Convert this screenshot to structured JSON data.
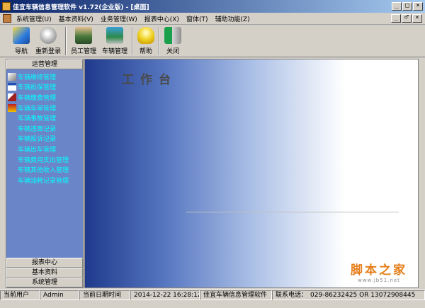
{
  "window": {
    "title": "佳宜车辆信息管理软件 v1.72(企业版) - [桌面]",
    "controls": [
      "_",
      "□",
      "×"
    ]
  },
  "menubar": {
    "items": [
      "系统管理(U)",
      "基本资料(V)",
      "业务管理(W)",
      "报表中心(X)",
      "窗体(T)",
      "辅助功能(Z)"
    ],
    "mdi_controls": [
      "_",
      "♂",
      "×"
    ]
  },
  "toolbar": {
    "buttons": [
      {
        "label": "导航",
        "icon": "wand-icon",
        "color": "#2c7be0"
      },
      {
        "label": "重新登录",
        "icon": "lock-icon",
        "color": "#c0c0c0"
      },
      {
        "label": "员工管理",
        "icon": "users-icon",
        "color": "#4a7a3c"
      },
      {
        "label": "车辆管理",
        "icon": "vehicle-icon",
        "color": "#2c8a4a"
      },
      {
        "label": "帮助",
        "icon": "lightbulb-icon",
        "color": "#f0d020"
      },
      {
        "label": "关闭",
        "icon": "exit-door-icon",
        "color": "#1aa04a"
      }
    ]
  },
  "sidebar": {
    "header": "运营管理",
    "items": [
      {
        "label": "车辆维修管理",
        "icon": "wrench-icon"
      },
      {
        "label": "车辆投保管理",
        "icon": "document-icon"
      },
      {
        "label": "车辆缴费管理",
        "icon": "pen-icon"
      },
      {
        "label": "车辆年审管理",
        "icon": "calendar-icon"
      },
      {
        "label": "车辆事故管理",
        "icon": ""
      },
      {
        "label": "车辆违章记录",
        "icon": ""
      },
      {
        "label": "车辆投诉记录",
        "icon": ""
      },
      {
        "label": "车辆出车管理",
        "icon": ""
      },
      {
        "label": "车辆费用支出管理",
        "icon": ""
      },
      {
        "label": "车辆其他收入管理",
        "icon": ""
      },
      {
        "label": "车辆油耗记录管理",
        "icon": ""
      }
    ],
    "bottom_panels": [
      "报表中心",
      "基本资料",
      "系统管理"
    ]
  },
  "workspace": {
    "title": "工作台",
    "watermark": "脚本之家",
    "watermark_url": "www.jb51.net"
  },
  "status": {
    "current_user_label": "当前用户",
    "current_user": "Admin",
    "date_label": "当前日期时间",
    "datetime": "2014-12-22 16:28:12",
    "app_name": "佳宜车辆信息管理软件",
    "phone_label": "联系电话：",
    "phone": "029-86232425 OR 13072908445"
  },
  "colors": {
    "sidebar_bg": "#6b86c8",
    "sidebar_text": "#00ffff",
    "titlebar": "#0a246a",
    "watermark": "#e57e1a"
  }
}
